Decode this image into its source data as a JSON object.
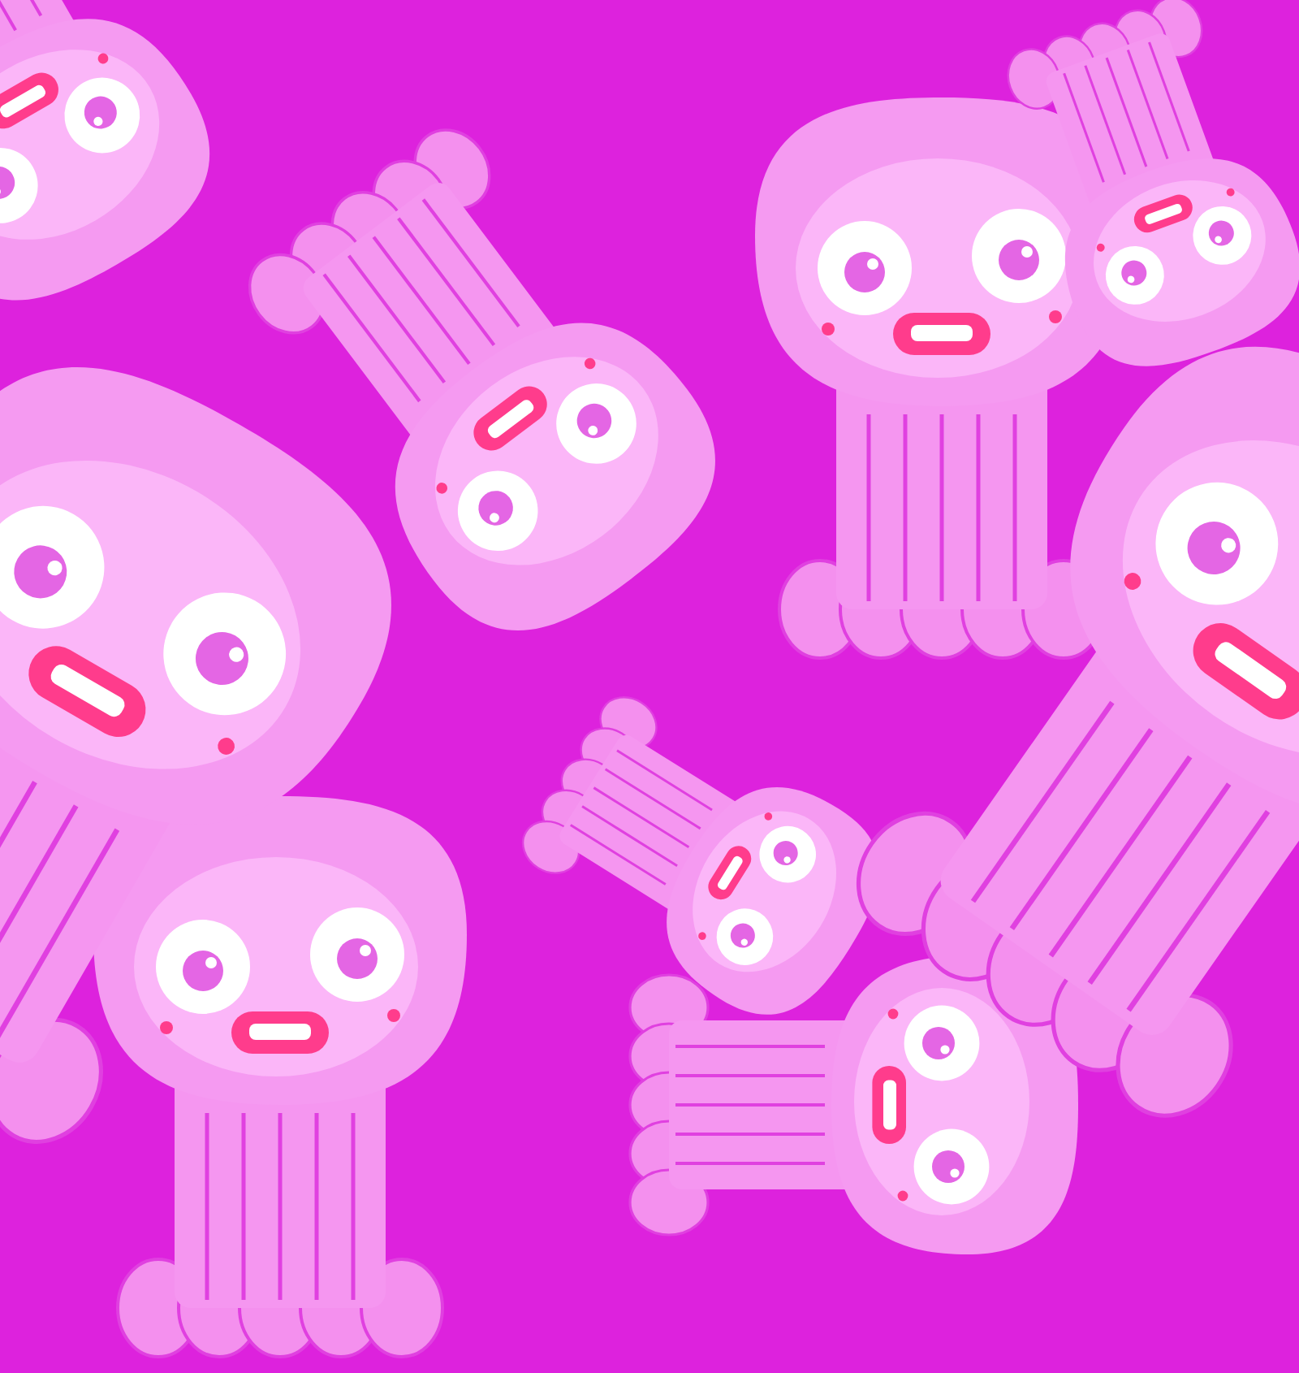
{
  "pattern": {
    "figures": [
      {
        "kind": "jellyfish"
      },
      {
        "kind": "jellyfish"
      },
      {
        "kind": "jellyfish"
      },
      {
        "kind": "jellyfish"
      },
      {
        "kind": "jellyfish"
      },
      {
        "kind": "jellyfish"
      },
      {
        "kind": "jellyfish"
      },
      {
        "kind": "jellyfish"
      },
      {
        "kind": "jellyfish"
      }
    ]
  }
}
